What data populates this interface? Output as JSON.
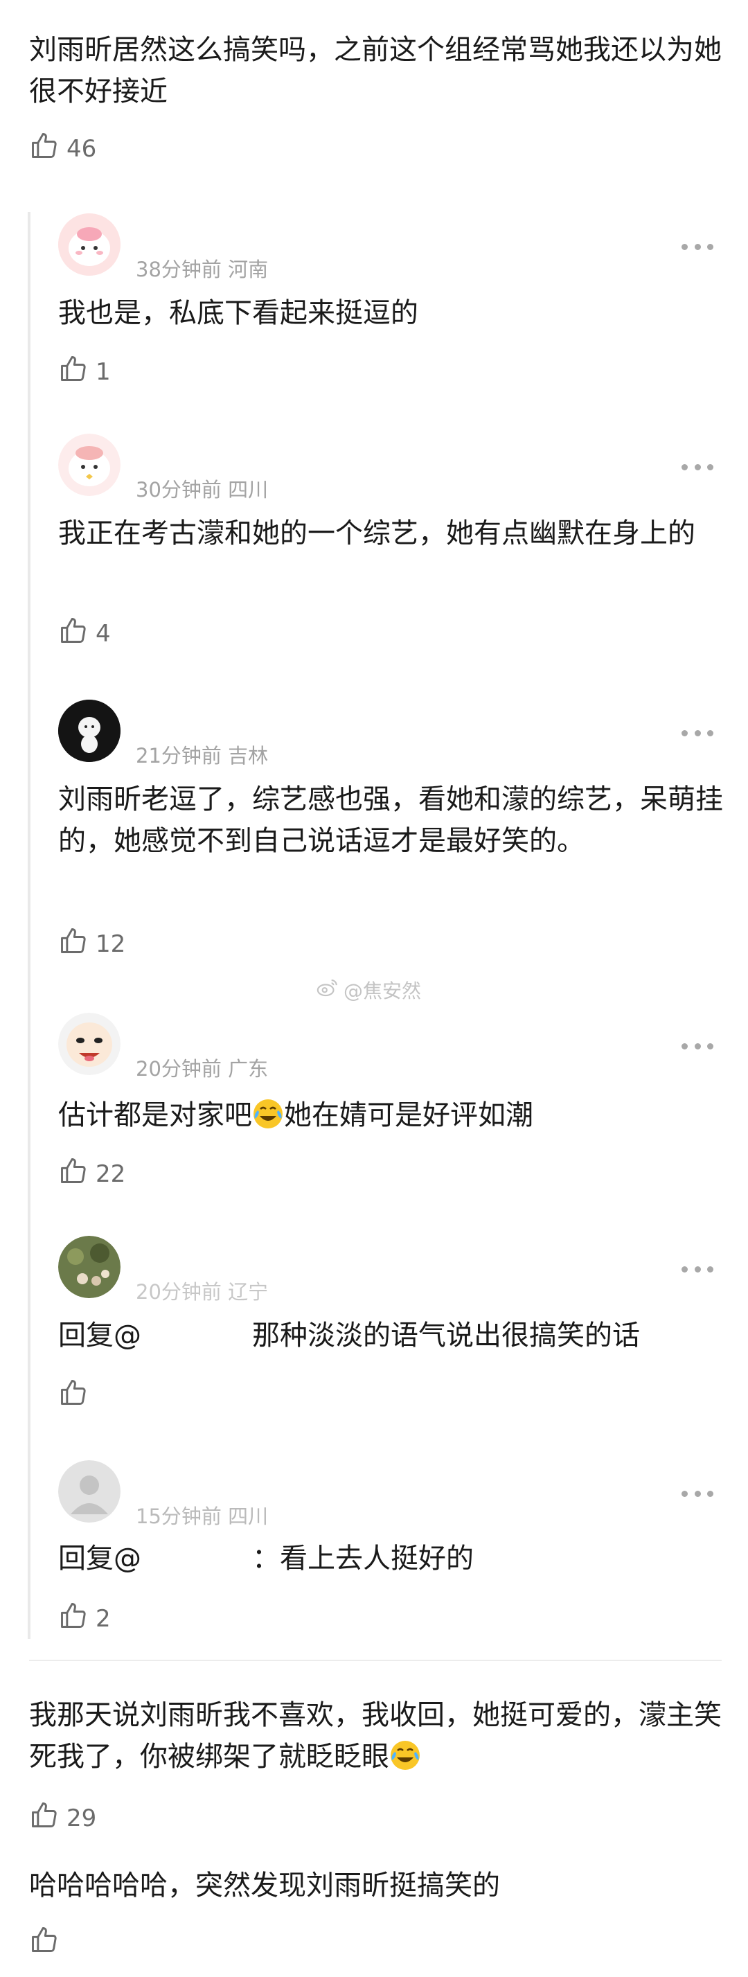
{
  "comments": [
    {
      "text": "刘雨昕居然这么搞笑吗，之前这个组经常骂她我还以为她很不好接近",
      "likes": "46"
    },
    {
      "text_part1": "我那天说刘雨昕我不喜欢，我收回，她挺可爱的，濛主笑死我了，你被绑架了就眨眨眼",
      "likes": "29"
    },
    {
      "text": "哈哈哈哈哈，突然发现刘雨昕挺搞笑的",
      "likes": ""
    }
  ],
  "replies": [
    {
      "meta": "38分钟前 河南",
      "text": "我也是，私底下看起来挺逗的",
      "likes": "1"
    },
    {
      "meta": "30分钟前 四川",
      "text": "我正在考古濛和她的一个综艺，她有点幽默在身上的",
      "likes": "4"
    },
    {
      "meta": "21分钟前 吉林",
      "text": "刘雨昕老逗了，综艺感也强，看她和濛的综艺，呆萌挂的，她感觉不到自己说话逗才是最好笑的。",
      "likes": "12"
    },
    {
      "meta": "20分钟前 广东",
      "text_part1": "估计都是对家吧",
      "text_part2": "她在婧可是好评如潮",
      "likes": "22"
    },
    {
      "meta": "20分钟前 辽宁",
      "reply_prefix": "回复@",
      "text": "那种淡淡的语气说出很搞笑的话",
      "likes": ""
    },
    {
      "meta": "15分钟前 四川",
      "reply_prefix": "回复@",
      "text": "：看上去人挺好的",
      "likes": "2"
    }
  ],
  "watermark": "@焦安然",
  "colors": {
    "text": "#1a1a1a",
    "meta": "#a3a3a3",
    "icon": "#6b6b6b",
    "divider": "#ececec"
  },
  "icons": [
    "thumbs-up-icon",
    "more-icon",
    "laugh-cry-emoji"
  ]
}
